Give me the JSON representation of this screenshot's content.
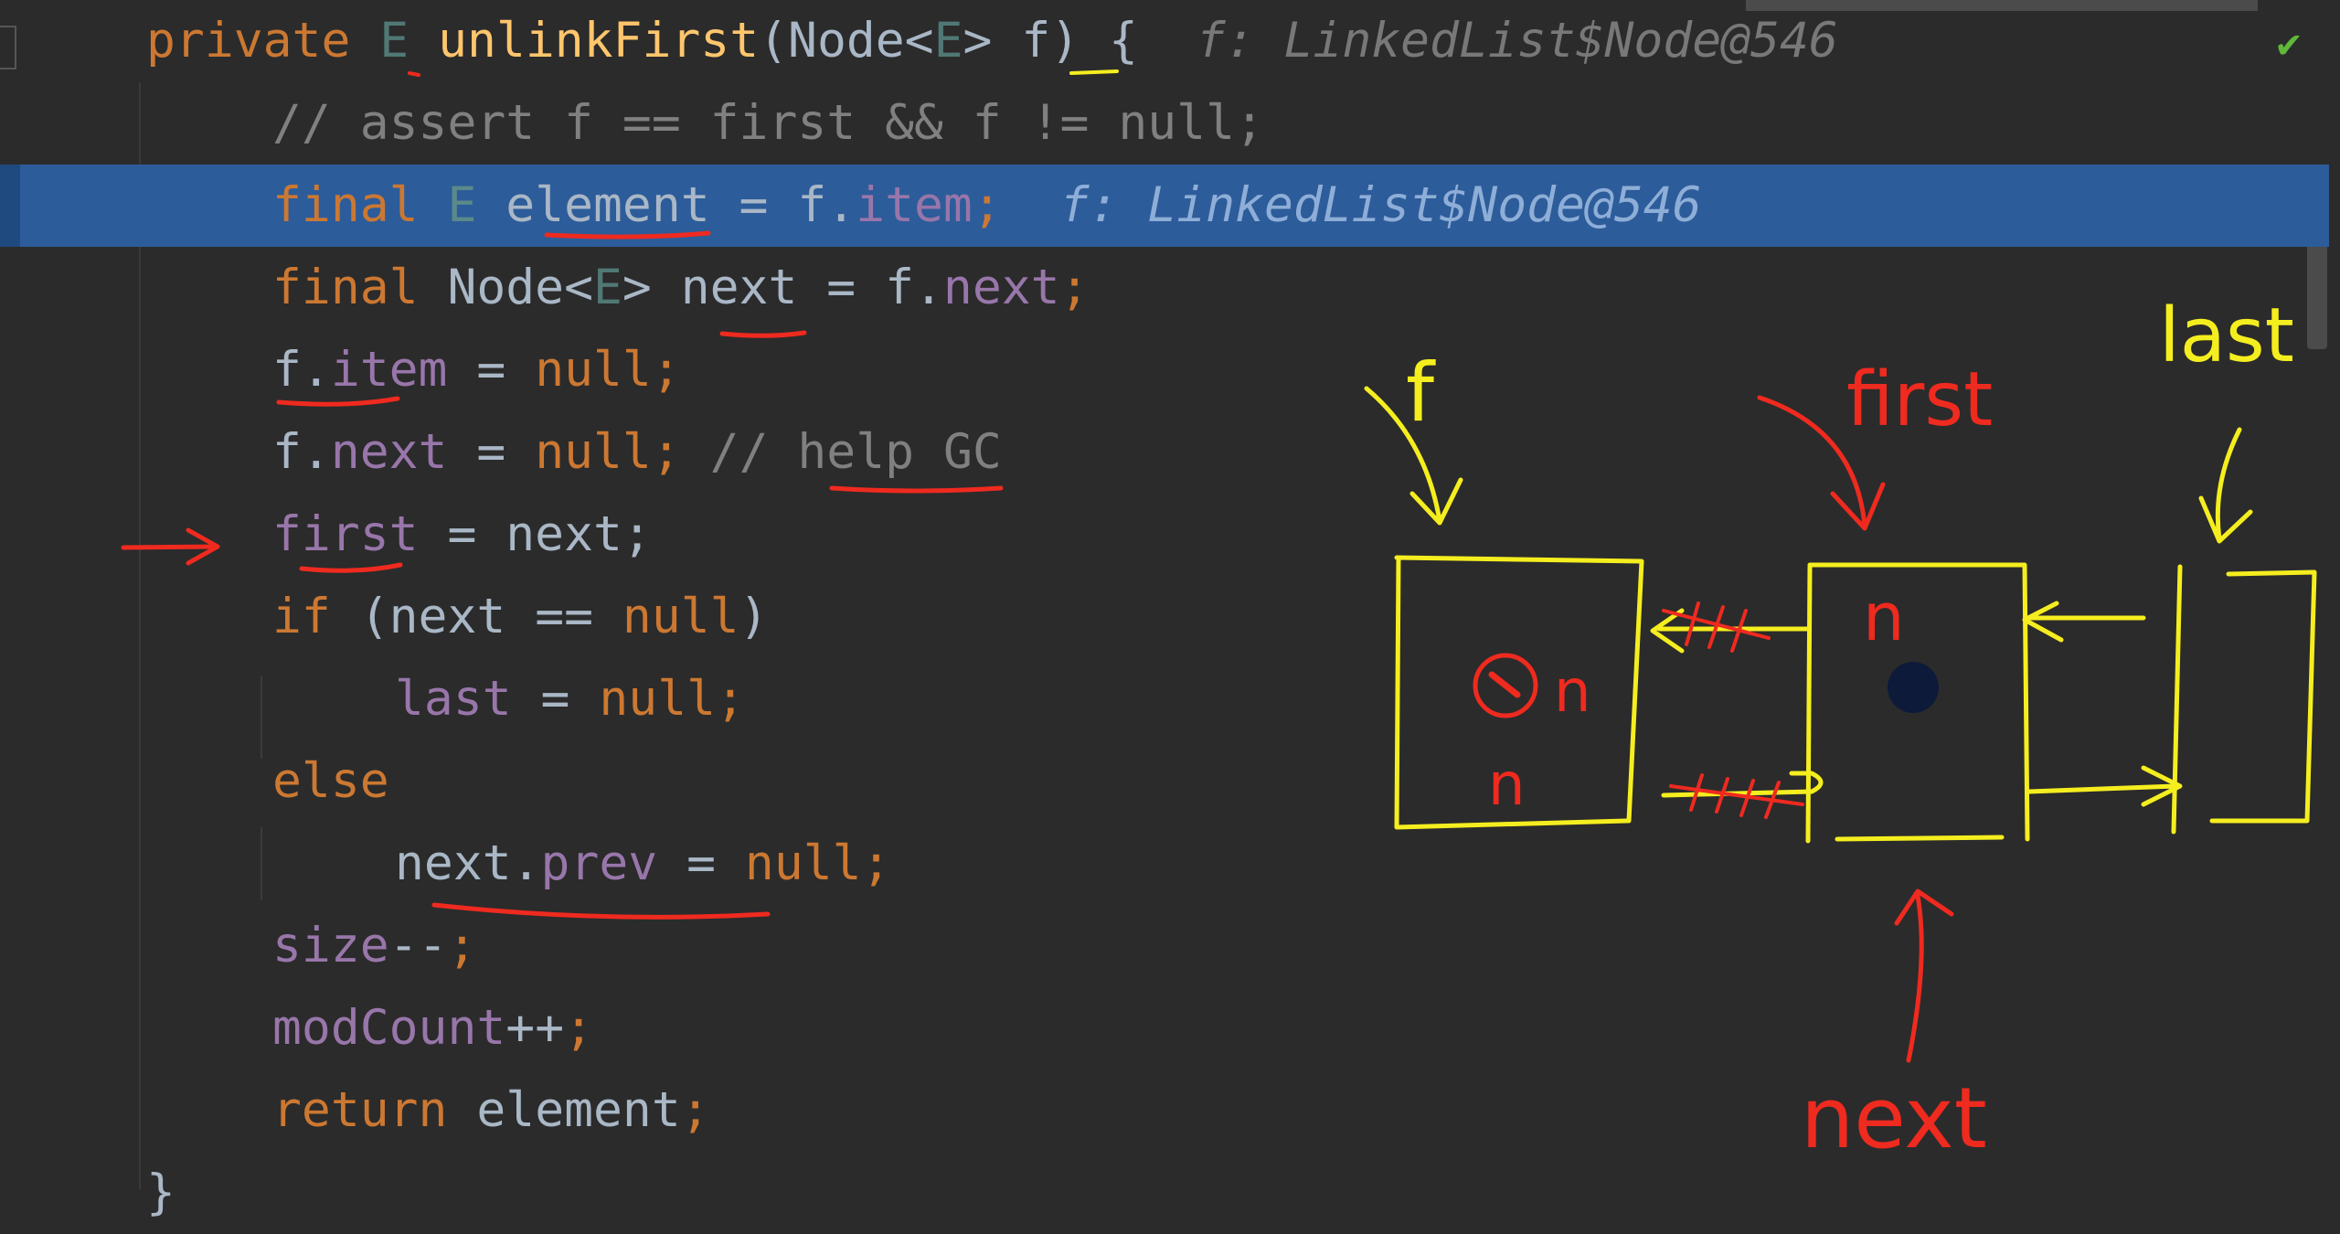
{
  "editor": {
    "lines": [
      {
        "segs": [
          {
            "t": "private ",
            "c": "kw"
          },
          {
            "t": "E",
            "c": "tp"
          },
          {
            "t": " "
          },
          {
            "t": "unlinkFirst",
            "c": "fn"
          },
          {
            "t": "(Node<"
          },
          {
            "t": "E",
            "c": "tp"
          },
          {
            "t": "> f) {"
          },
          {
            "t": "  f: LinkedList$Node@546",
            "c": "hint"
          }
        ]
      },
      {
        "segs": [
          {
            "t": "// assert f == first && f != null;",
            "c": "cm"
          }
        ]
      },
      {
        "segs": [
          {
            "t": "final ",
            "c": "kw"
          },
          {
            "t": "E",
            "c": "tp"
          },
          {
            "t": " element = f."
          },
          {
            "t": "item",
            "c": "fld"
          },
          {
            "t": ";",
            "c": "kw"
          },
          {
            "t": "  f: LinkedList$Node@546",
            "c": "hint"
          }
        ]
      },
      {
        "segs": [
          {
            "t": "final ",
            "c": "kw"
          },
          {
            "t": "Node<"
          },
          {
            "t": "E",
            "c": "tp"
          },
          {
            "t": "> next = f."
          },
          {
            "t": "next",
            "c": "fld"
          },
          {
            "t": ";",
            "c": "kw"
          }
        ]
      },
      {
        "segs": [
          {
            "t": "f."
          },
          {
            "t": "item",
            "c": "fld"
          },
          {
            "t": " = "
          },
          {
            "t": "null",
            "c": "kw"
          },
          {
            "t": ";",
            "c": "kw"
          }
        ]
      },
      {
        "segs": [
          {
            "t": "f."
          },
          {
            "t": "next",
            "c": "fld"
          },
          {
            "t": " = "
          },
          {
            "t": "null",
            "c": "kw"
          },
          {
            "t": ";",
            "c": "kw"
          },
          {
            "t": " // help GC",
            "c": "cm"
          }
        ]
      },
      {
        "segs": [
          {
            "t": "first",
            "c": "fld"
          },
          {
            "t": " = next;",
            "c": ""
          }
        ]
      },
      {
        "segs": [
          {
            "t": "if",
            "c": "kw"
          },
          {
            "t": " (next == "
          },
          {
            "t": "null",
            "c": "kw"
          },
          {
            "t": ")"
          }
        ]
      },
      {
        "segs": [
          {
            "t": "last",
            "c": "fld"
          },
          {
            "t": " = "
          },
          {
            "t": "null",
            "c": "kw"
          },
          {
            "t": ";",
            "c": "kw"
          }
        ]
      },
      {
        "segs": [
          {
            "t": "else",
            "c": "kw"
          }
        ]
      },
      {
        "segs": [
          {
            "t": "next."
          },
          {
            "t": "prev",
            "c": "fld"
          },
          {
            "t": " = "
          },
          {
            "t": "null",
            "c": "kw"
          },
          {
            "t": ";",
            "c": "kw"
          }
        ]
      },
      {
        "segs": [
          {
            "t": "size",
            "c": "fld"
          },
          {
            "t": "--"
          },
          {
            "t": ";",
            "c": "kw"
          }
        ]
      },
      {
        "segs": [
          {
            "t": "modCount",
            "c": "fld"
          },
          {
            "t": "++"
          },
          {
            "t": ";",
            "c": "kw"
          }
        ]
      },
      {
        "segs": [
          {
            "t": "return ",
            "c": "kw"
          },
          {
            "t": "element"
          },
          {
            "t": ";",
            "c": "kw"
          }
        ]
      },
      {
        "segs": [
          {
            "t": "}"
          }
        ]
      }
    ]
  },
  "annotations": {
    "label_f": "f",
    "label_first": "first",
    "label_last": "last",
    "label_next": "next",
    "box_n_top": "n",
    "box_n_mid": "n",
    "box_n_bottom": "n",
    "ink_yellow": "#f5ee1f",
    "ink_red": "#ef2a1f"
  },
  "status": {
    "check_icon": "✔"
  }
}
